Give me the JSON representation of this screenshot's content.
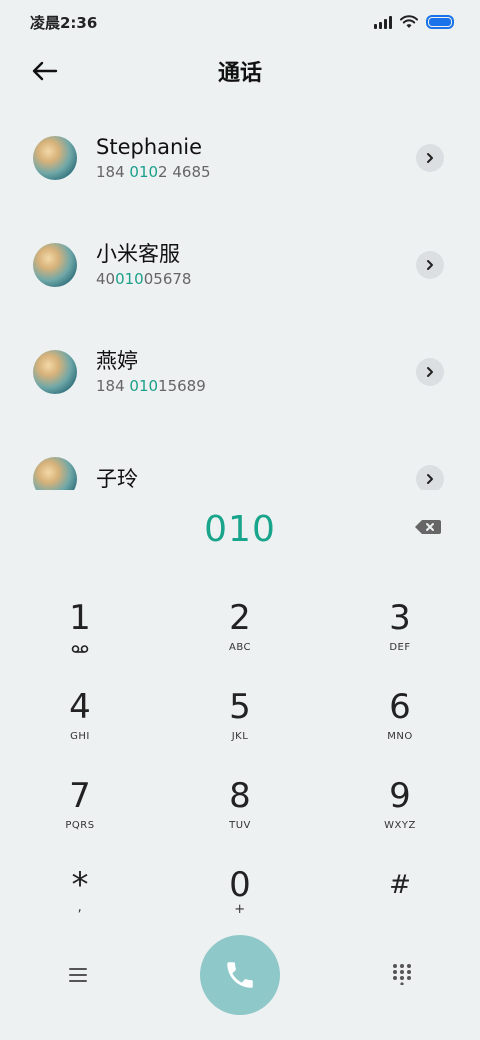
{
  "status_bar": {
    "time": "凌晨2:36",
    "icons": [
      "signal-icon",
      "wifi-icon",
      "battery-icon"
    ],
    "battery_color": "#1a73e8"
  },
  "header": {
    "title": "通话",
    "back_icon": "back-arrow-icon"
  },
  "contacts": [
    {
      "name": "Stephanie",
      "number_pre": "184 ",
      "number_match": "010",
      "number_post": "2 4685"
    },
    {
      "name": "小米客服",
      "number_pre": "40",
      "number_match": "010",
      "number_post": "05678"
    },
    {
      "name": "燕婷",
      "number_pre": "184 ",
      "number_match": "010",
      "number_post": "15689"
    },
    {
      "name": "子玲",
      "number_pre": "",
      "number_match": "",
      "number_post": ""
    }
  ],
  "dial": {
    "number": "010",
    "backspace_icon": "backspace-icon",
    "accent_color": "#19a58c"
  },
  "keypad": [
    {
      "digit": "1",
      "letters": ""
    },
    {
      "digit": "2",
      "letters": "ABC"
    },
    {
      "digit": "3",
      "letters": "DEF"
    },
    {
      "digit": "4",
      "letters": "GHI"
    },
    {
      "digit": "5",
      "letters": "JKL"
    },
    {
      "digit": "6",
      "letters": "MNO"
    },
    {
      "digit": "7",
      "letters": "PQRS"
    },
    {
      "digit": "8",
      "letters": "TUV"
    },
    {
      "digit": "9",
      "letters": "WXYZ"
    },
    {
      "digit": "*",
      "letters": ","
    },
    {
      "digit": "0",
      "letters": "+"
    },
    {
      "digit": "#",
      "letters": ""
    }
  ],
  "bottom_bar": {
    "menu_icon": "menu-icon",
    "call_icon": "phone-icon",
    "dialpad_icon": "dialpad-icon",
    "call_color": "#8fc8c9"
  }
}
